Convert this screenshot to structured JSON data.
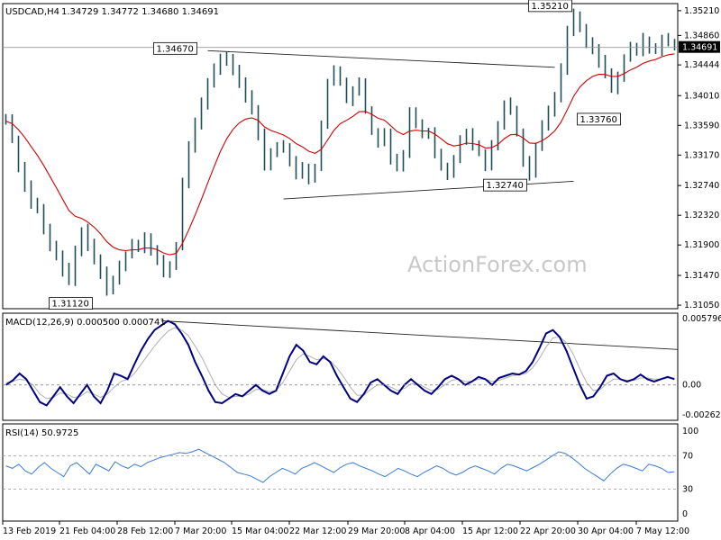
{
  "chart_data": [
    {
      "type": "candlestick",
      "symbol_label": "USDCAD,H4",
      "ohlc_label": "1.34729 1.34772 1.34680 1.34691",
      "current_price_label": "1.34691",
      "watermark": "ActionForex.com",
      "y_ticks": [
        "1.35210",
        "1.34860",
        "1.34444",
        "1.34010",
        "1.33590",
        "1.33170",
        "1.32740",
        "1.32320",
        "1.31900",
        "1.31470",
        "1.31050"
      ],
      "x_ticks": [
        "13 Feb 2019",
        "21 Feb 04:00",
        "28 Feb 12:00",
        "7 Mar 20:00",
        "15 Mar 04:00",
        "22 Mar 12:00",
        "29 Mar 20:00",
        "8 Apr 04:00",
        "15 Apr 12:00",
        "22 Apr 20:00",
        "30 Apr 04:00",
        "7 May 12:00"
      ],
      "annotations": [
        {
          "text": "1.35210"
        },
        {
          "text": "1.34670"
        },
        {
          "text": "1.33760"
        },
        {
          "text": "1.32740"
        },
        {
          "text": "1.31120"
        }
      ],
      "close_path": [
        1.3365,
        1.334,
        1.33,
        1.3275,
        1.325,
        1.324,
        1.3215,
        1.319,
        1.3175,
        1.3155,
        1.314,
        1.318,
        1.321,
        1.319,
        1.317,
        1.315,
        1.3125,
        1.314,
        1.316,
        1.3175,
        1.319,
        1.3185,
        1.32,
        1.3185,
        1.317,
        1.315,
        1.316,
        1.319,
        1.328,
        1.333,
        1.336,
        1.339,
        1.342,
        1.344,
        1.3455,
        1.345,
        1.3435,
        1.342,
        1.34,
        1.338,
        1.3345,
        1.33,
        1.332,
        1.333,
        1.3325,
        1.331,
        1.329,
        1.33,
        1.3285,
        1.33,
        1.336,
        1.342,
        1.3435,
        1.342,
        1.3395,
        1.3405,
        1.342,
        1.338,
        1.335,
        1.3335,
        1.335,
        1.331,
        1.33,
        1.332,
        1.338,
        1.336,
        1.3345,
        1.335,
        1.332,
        1.33,
        1.329,
        1.331,
        1.334,
        1.335,
        1.333,
        1.332,
        1.33,
        1.333,
        1.336,
        1.339,
        1.338,
        1.335,
        1.331,
        1.329,
        1.333,
        1.336,
        1.338,
        1.34,
        1.344,
        1.349,
        1.3515,
        1.3495,
        1.3475,
        1.3465,
        1.345,
        1.343,
        1.341,
        1.343,
        1.3455,
        1.347,
        1.3465,
        1.348,
        1.347,
        1.3465,
        1.348,
        1.3475,
        1.3469
      ],
      "series": [
        {
          "name": "MA",
          "color": "#d40000"
        },
        {
          "name": "MACD",
          "color": "#000080"
        },
        {
          "name": "Signal",
          "color": "#b0b0b0"
        },
        {
          "name": "RSI",
          "color": "#3a7ad6"
        }
      ],
      "trendlines_note": "upper trendline from 1.34670 high; lower trendline from 1.32740 low",
      "indicators": [
        {
          "type": "line",
          "label": "MACD(12,26,9) 0.000500 0.000741",
          "y_ticks": [
            "0.005796",
            "0.00",
            "-0.002623"
          ],
          "ylim": [
            -0.002623,
            0.005796
          ],
          "macd": [
            0.0,
            0.0004,
            0.001,
            0.0005,
            -0.0005,
            -0.0015,
            -0.0018,
            -0.001,
            -0.0002,
            -0.001,
            -0.0016,
            -0.0008,
            0.0,
            -0.001,
            -0.0016,
            -0.0005,
            0.001,
            0.0008,
            0.0005,
            0.0018,
            0.003,
            0.004,
            0.0048,
            0.0052,
            0.0056,
            0.0053,
            0.0045,
            0.0035,
            0.002,
            0.0008,
            -0.0005,
            -0.0015,
            -0.0016,
            -0.0012,
            -0.0008,
            -0.001,
            -0.0005,
            0.0,
            -0.0005,
            -0.0008,
            -0.0005,
            0.001,
            0.0025,
            0.0035,
            0.003,
            0.002,
            0.0018,
            0.0025,
            0.002,
            0.0008,
            -0.0002,
            -0.0012,
            -0.0015,
            -0.0008,
            0.0002,
            0.0005,
            0.0,
            -0.0005,
            -0.0008,
            0.0,
            0.0005,
            0.0,
            -0.0005,
            -0.0008,
            -0.0002,
            0.0005,
            0.0008,
            0.0005,
            0.0,
            0.0003,
            0.0007,
            0.0005,
            0.0,
            0.0006,
            0.0008,
            0.001,
            0.0009,
            0.0012,
            0.002,
            0.0032,
            0.0045,
            0.0048,
            0.0042,
            0.003,
            0.0015,
            0.0,
            -0.0012,
            -0.001,
            -0.0002,
            0.0008,
            0.001,
            0.0005,
            0.0003,
            0.0005,
            0.0009,
            0.0005,
            0.0003,
            0.0005,
            0.0007,
            0.0005
          ],
          "signal": [
            0.0002,
            0.0003,
            0.0005,
            0.0004,
            0.0,
            -0.0008,
            -0.0012,
            -0.0011,
            -0.0007,
            -0.0008,
            -0.0011,
            -0.001,
            -0.0006,
            -0.0008,
            -0.0011,
            -0.0008,
            -0.0002,
            0.0003,
            0.0005,
            0.001,
            0.0018,
            0.0026,
            0.0034,
            0.0041,
            0.0047,
            0.005,
            0.0048,
            0.0043,
            0.0034,
            0.0024,
            0.0012,
            0.0,
            -0.0008,
            -0.0011,
            -0.001,
            -0.001,
            -0.0008,
            -0.0004,
            -0.0004,
            -0.0006,
            -0.0005,
            0.0002,
            0.0012,
            0.0022,
            0.0027,
            0.0025,
            0.0022,
            0.0023,
            0.0021,
            0.0015,
            0.0007,
            -0.0002,
            -0.0009,
            -0.0009,
            -0.0004,
            0.0,
            0.0,
            -0.0002,
            -0.0005,
            -0.0003,
            0.0001,
            0.0001,
            -0.0002,
            -0.0005,
            -0.0004,
            0.0,
            0.0004,
            0.0005,
            0.0003,
            0.0003,
            0.0005,
            0.0005,
            0.0003,
            0.0004,
            0.0006,
            0.0008,
            0.0009,
            0.001,
            0.0015,
            0.0023,
            0.0033,
            0.0041,
            0.0042,
            0.0037,
            0.0027,
            0.0014,
            0.0002,
            -0.0005,
            -0.0004,
            0.0001,
            0.0005,
            0.0005,
            0.0004,
            0.0004,
            0.0006,
            0.0006,
            0.0005,
            0.0005,
            0.0006,
            0.0006
          ]
        },
        {
          "type": "line",
          "label": "RSI(14) 50.9725",
          "y_ticks": [
            "100",
            "70",
            "30",
            "0"
          ],
          "ylim": [
            0,
            100
          ],
          "values": [
            58,
            55,
            60,
            52,
            48,
            56,
            62,
            55,
            50,
            45,
            58,
            62,
            55,
            48,
            60,
            56,
            52,
            63,
            58,
            55,
            60,
            57,
            62,
            65,
            68,
            70,
            72,
            74,
            73,
            75,
            78,
            74,
            70,
            66,
            62,
            56,
            50,
            48,
            46,
            42,
            38,
            45,
            50,
            55,
            52,
            48,
            55,
            58,
            62,
            58,
            54,
            50,
            56,
            60,
            62,
            58,
            55,
            52,
            48,
            45,
            50,
            55,
            52,
            48,
            45,
            50,
            54,
            58,
            55,
            50,
            47,
            50,
            55,
            58,
            55,
            52,
            48,
            55,
            60,
            58,
            55,
            52,
            56,
            60,
            65,
            70,
            75,
            73,
            68,
            62,
            55,
            50,
            45,
            40,
            48,
            55,
            60,
            58,
            55,
            52,
            60,
            58,
            55,
            50,
            51
          ]
        }
      ]
    }
  ]
}
